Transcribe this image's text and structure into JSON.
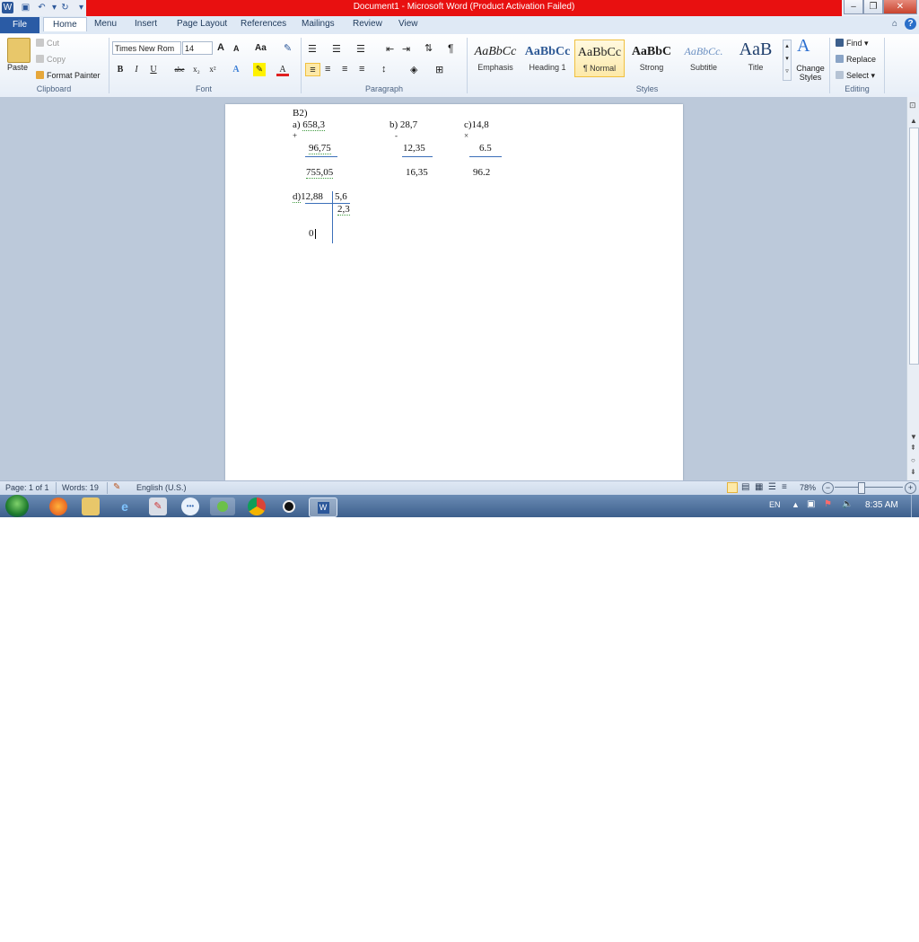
{
  "window": {
    "title": "Document1  -  Microsoft Word (Product Activation Failed)",
    "title_bar_color": "#e81010",
    "controls": [
      "minimize-icon",
      "restore-icon",
      "close-icon"
    ]
  },
  "quick_access": [
    "word-logo-icon",
    "save-icon",
    "undo-icon",
    "redo-icon",
    "customize-icon"
  ],
  "tabs": [
    {
      "label": "File"
    },
    {
      "label": "Home"
    },
    {
      "label": "Menu"
    },
    {
      "label": "Insert"
    },
    {
      "label": "Page Layout"
    },
    {
      "label": "References"
    },
    {
      "label": "Mailings"
    },
    {
      "label": "Review"
    },
    {
      "label": "View"
    }
  ],
  "ribbon": {
    "clipboard": {
      "paste": "Paste",
      "cut": "Cut",
      "copy": "Copy",
      "format_painter": "Format Painter",
      "label": "Clipboard"
    },
    "font": {
      "family": "Times New Rom",
      "size": "14",
      "grow": "A",
      "shrink": "A",
      "change_case": "Aa",
      "bold": "B",
      "italic": "I",
      "underline": "U",
      "strike": "abe",
      "subscript": "x₂",
      "superscript": "x²",
      "label": "Font"
    },
    "paragraph": {
      "label": "Paragraph"
    },
    "styles": {
      "items": [
        {
          "preview": "AaBbCc",
          "name": "Emphasis"
        },
        {
          "preview": "AaBbCc",
          "name": "Heading 1"
        },
        {
          "preview": "AaBbCc",
          "name": "¶ Normal"
        },
        {
          "preview": "AaBbC",
          "name": "Strong"
        },
        {
          "preview": "AaBbCc.",
          "name": "Subtitle"
        },
        {
          "preview": "AaB",
          "name": "Title"
        }
      ],
      "change_styles": "Change Styles",
      "label": "Styles"
    },
    "editing": {
      "find": "Find",
      "replace": "Replace",
      "select": "Select",
      "label": "Editing"
    }
  },
  "document": {
    "heading": "B2)",
    "problem_a": {
      "label": "a)",
      "top": "658,3",
      "op": "+",
      "second": "96,75",
      "result": "755,05"
    },
    "problem_b": {
      "label": "b)",
      "top": "28,7",
      "op": "-",
      "second": "12,35",
      "result": "16,35"
    },
    "problem_c": {
      "label": "c)",
      "top": "14,8",
      "op": "×",
      "second": "6.5",
      "result": "96.2"
    },
    "problem_d": {
      "label": "d)",
      "dividend": "12,88",
      "divisor": "5,6",
      "quotient": "2,3",
      "remainder": "0"
    }
  },
  "status": {
    "page": "Page: 1 of 1",
    "words": "Words: 19",
    "language": "English (U.S.)",
    "zoom": "78%"
  },
  "taskbar": {
    "icons": [
      "start-orb",
      "firefox-icon",
      "file-explorer-icon",
      "internet-explorer-icon",
      "paint-icon",
      "chat-icon",
      "media-icon",
      "chrome-icon",
      "record-icon",
      "word-icon"
    ],
    "lang": "EN",
    "time": "8:35 AM"
  }
}
